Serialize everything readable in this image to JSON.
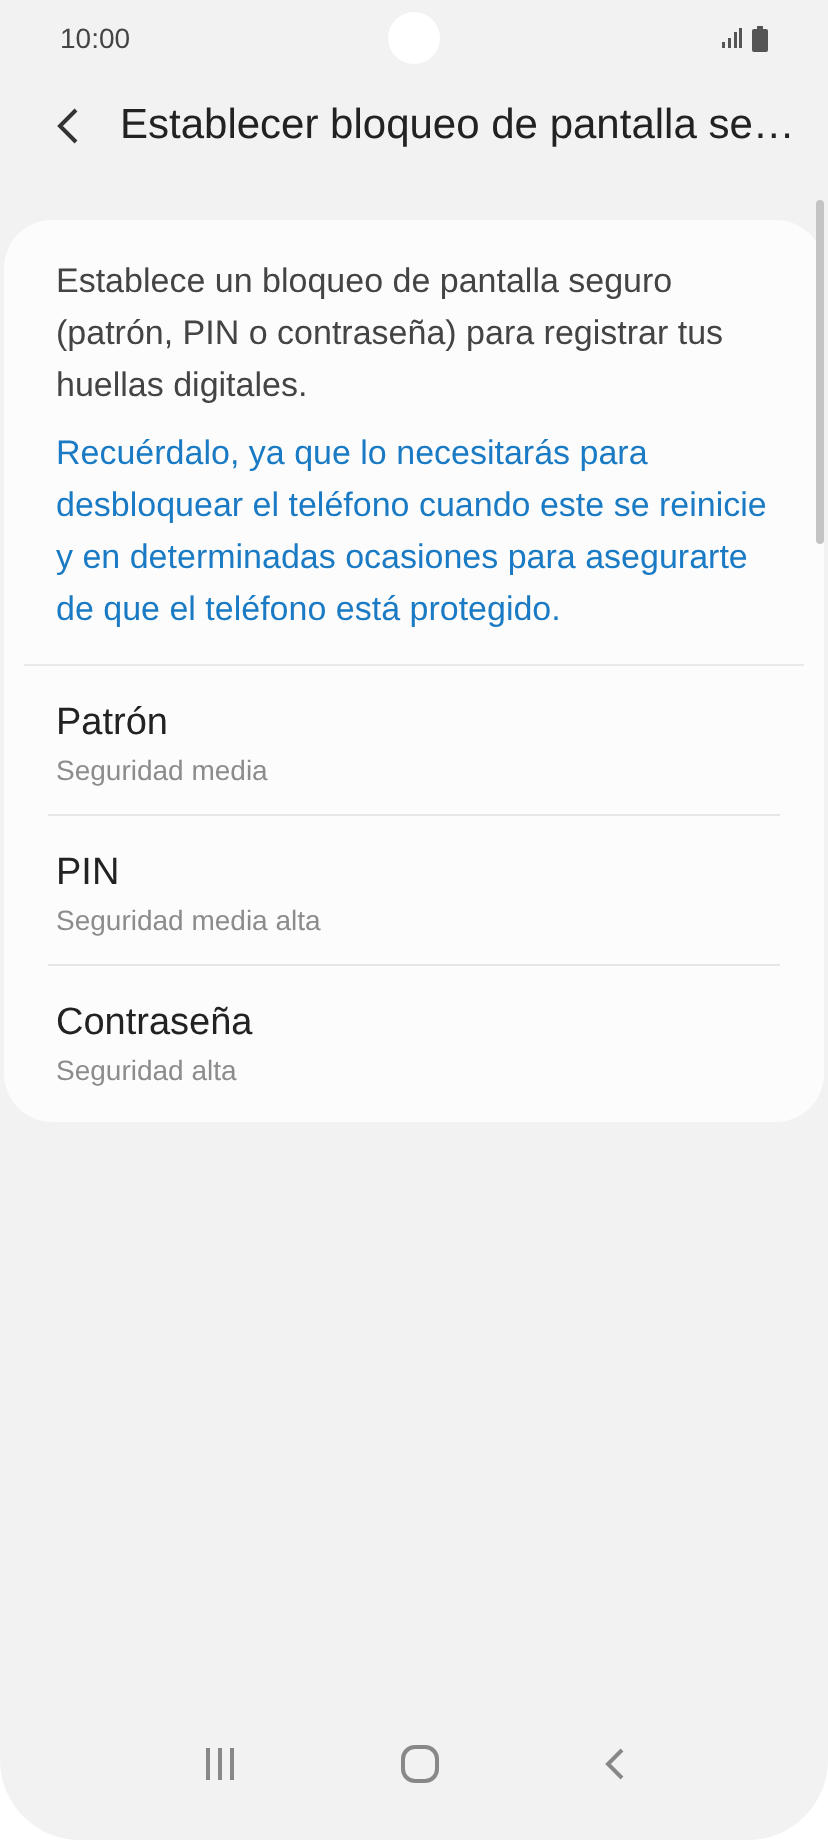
{
  "status_bar": {
    "time": "10:00"
  },
  "header": {
    "title": "Establecer bloqueo de pantalla se…"
  },
  "intro": {
    "text": "Establece un bloqueo de pantalla seguro (patrón, PIN o contraseña) para registrar tus huellas digitales.",
    "note": "Recuérdalo, ya que lo necesitarás para desbloquear el teléfono cuando este se reinicie y en determinadas ocasiones para asegurarte de que el teléfono está protegido."
  },
  "options": [
    {
      "title": "Patrón",
      "subtitle": "Seguridad media"
    },
    {
      "title": "PIN",
      "subtitle": "Seguridad media alta"
    },
    {
      "title": "Contraseña",
      "subtitle": "Seguridad alta"
    }
  ]
}
